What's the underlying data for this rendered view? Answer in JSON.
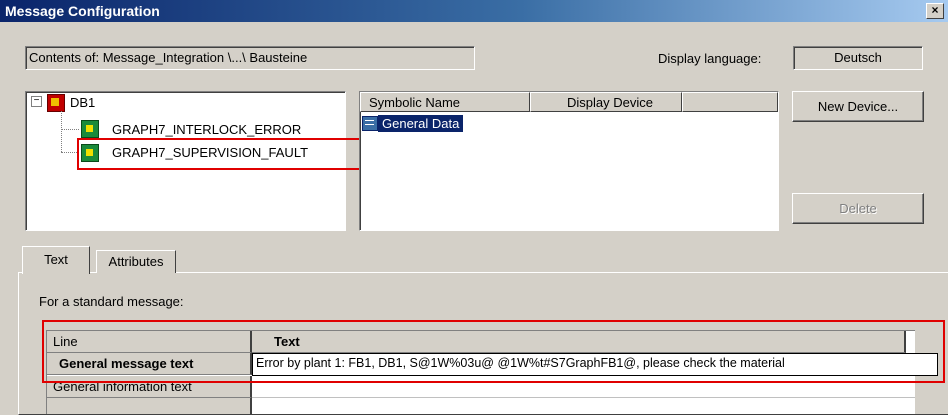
{
  "window": {
    "title": "Message Configuration",
    "close_glyph": "×"
  },
  "contents_field": "Contents of: Message_Integration \\...\\ Bausteine",
  "display_language": {
    "label": "Display language:",
    "value": "Deutsch"
  },
  "tree": {
    "expander": "−",
    "root": "DB1",
    "children": [
      "GRAPH7_INTERLOCK_ERROR",
      "GRAPH7_SUPERVISION_FAULT"
    ]
  },
  "device_list": {
    "columns": [
      "Symbolic Name",
      "Display Device"
    ],
    "rows": [
      {
        "name": "General Data"
      }
    ]
  },
  "buttons": {
    "new_device": "New Device...",
    "delete": "Delete"
  },
  "tabs": [
    "Text",
    "Attributes"
  ],
  "standard_message_label": "For a standard message:",
  "message_table": {
    "headers": [
      "Line",
      "Text"
    ],
    "rows": [
      {
        "line": "General message text",
        "text": "Error by plant 1:  FB1, DB1, S@1W%03u@  @1W%t#S7GraphFB1@, please check the material"
      },
      {
        "line": "General information text",
        "text": ""
      }
    ]
  },
  "colors": {
    "title_gradient_start": "#0a246a",
    "title_gradient_end": "#a6caf0",
    "highlight": "#0a246a",
    "annotation_red": "#e00000"
  }
}
